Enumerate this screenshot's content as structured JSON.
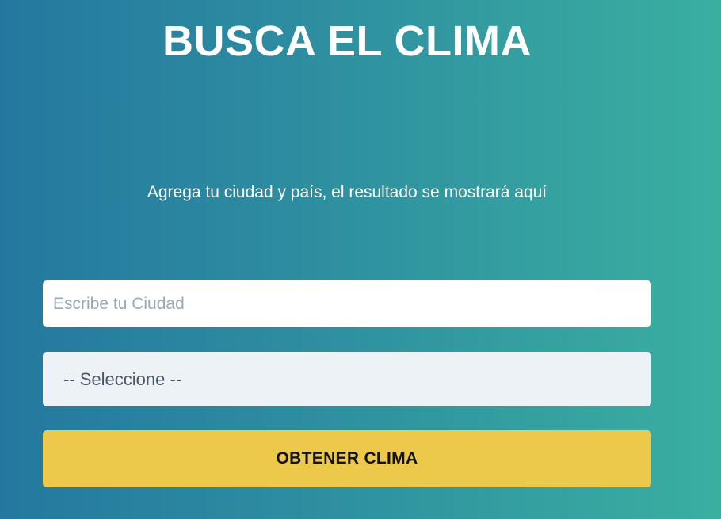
{
  "header": {
    "title": "BUSCA EL CLIMA"
  },
  "result": {
    "message": "Agrega tu ciudad y país, el resultado se mostrará aquí"
  },
  "form": {
    "city_input": {
      "placeholder": "Escribe tu Ciudad",
      "value": ""
    },
    "country_select": {
      "selected": "-- Seleccione --"
    },
    "submit_label": "OBTENER CLIMA"
  },
  "colors": {
    "gradient_start": "#24789f",
    "gradient_end": "#3aafa0",
    "button": "#ecc94b",
    "select_bg": "#edf2f7"
  }
}
